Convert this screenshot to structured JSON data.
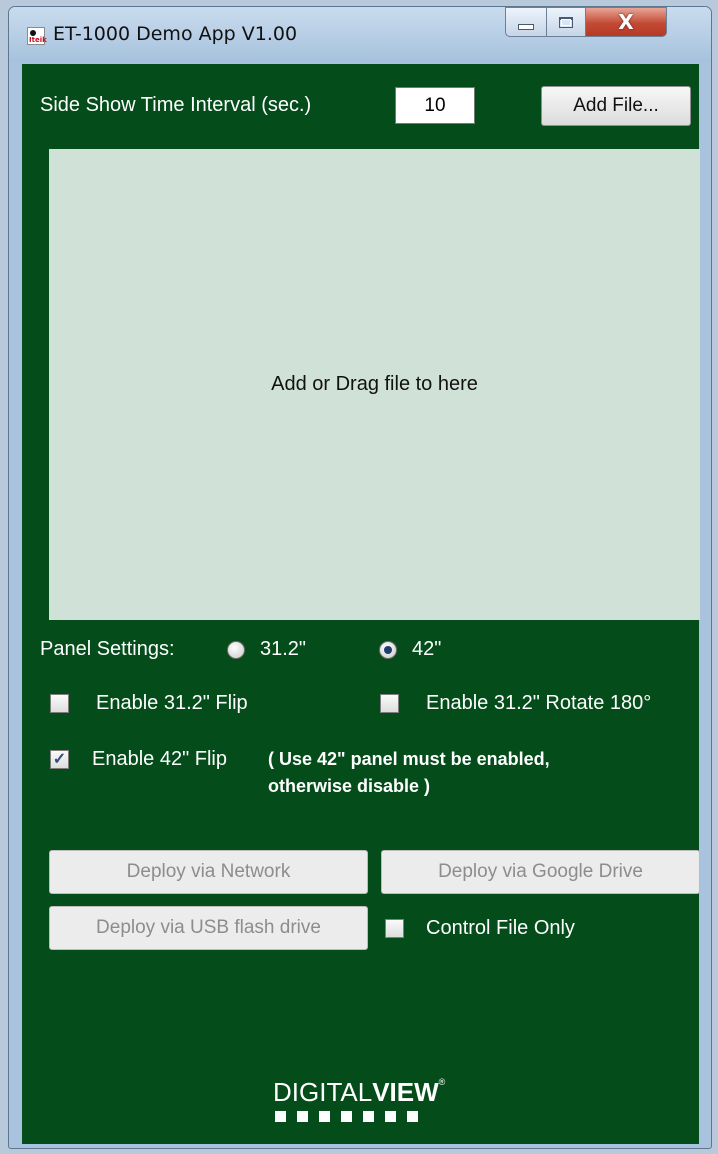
{
  "window": {
    "title": "ET-1000 Demo App V1.00",
    "app_icon_text": "Iteik",
    "close_glyph": "X"
  },
  "interval": {
    "label": "Side Show Time Interval (sec.)",
    "value": "10"
  },
  "add_file_label": "Add File...",
  "dropzone_text": "Add or Drag file to here",
  "panel": {
    "label": "Panel Settings:",
    "options": [
      {
        "label": "31.2\"",
        "selected": false
      },
      {
        "label": "42\"",
        "selected": true
      }
    ]
  },
  "options": {
    "flip_312": {
      "label": "Enable 31.2\" Flip",
      "checked": false
    },
    "rotate_312": {
      "label": "Enable 31.2\" Rotate 180°",
      "checked": false
    },
    "flip_42": {
      "label": "Enable 42\" Flip",
      "checked": true,
      "note_line1": "( Use 42\" panel must be enabled,",
      "note_line2": "otherwise disable )"
    }
  },
  "deploy": {
    "network": "Deploy via Network",
    "google_drive": "Deploy via Google Drive",
    "usb": "Deploy via USB flash drive",
    "control_file_only": {
      "label": "Control File Only",
      "checked": false
    }
  },
  "logo": {
    "part1": "DIGITAL",
    "part2": "VIEW",
    "mark": "®"
  },
  "colors": {
    "background": "#044d1a",
    "dropzone": "#d0e2d8"
  }
}
